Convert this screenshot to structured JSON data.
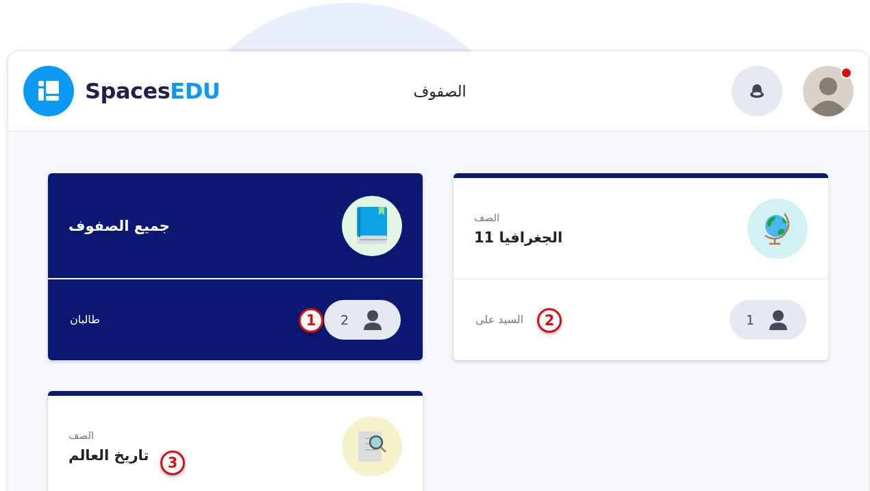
{
  "header": {
    "brand": {
      "first": "Spaces",
      "second": "EDU"
    },
    "title": "الصفوف",
    "notification_dot": true
  },
  "cards": [
    {
      "selected": false,
      "kind": "globe",
      "label": "الصف",
      "title": "الجغرافيا 11",
      "count": "1",
      "footer": "السيد على",
      "callout": "2"
    },
    {
      "selected": true,
      "kind": "book",
      "title": "جميع الصفوف",
      "count": "2",
      "footer": "طالبان",
      "callout": "1"
    },
    {
      "selected": false,
      "kind": "search-document",
      "label": "الصف",
      "title": "تاريخ العالم",
      "callout": "3"
    }
  ]
}
